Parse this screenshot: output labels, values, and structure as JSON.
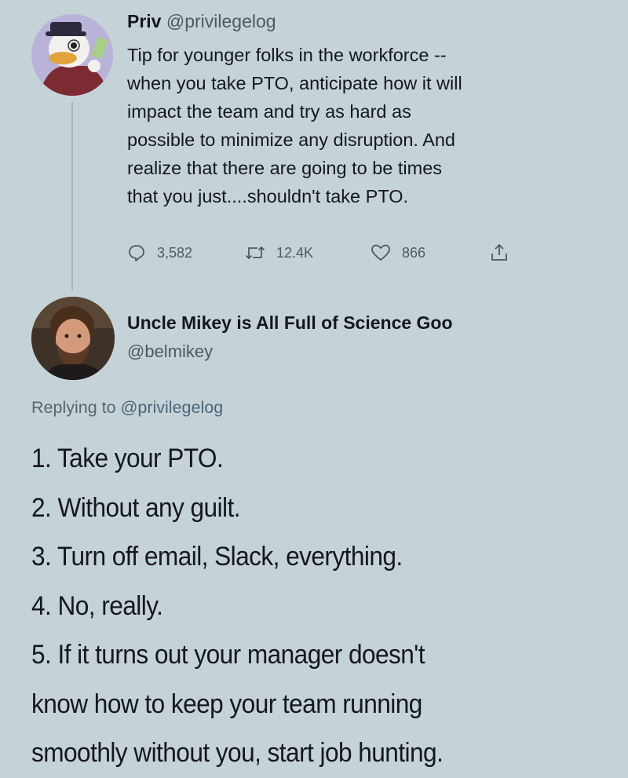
{
  "tweet": {
    "author": {
      "display_name": "Priv",
      "handle": "@privilegelog"
    },
    "text": "Tip for younger folks in the workforce --\nwhen you take PTO, anticipate how it will\nimpact the team and try as hard as\npossible to minimize any disruption. And\nrealize that there are going to be times\nthat you just....shouldn't take PTO.",
    "stats": {
      "replies": "3,582",
      "retweets": "12.4K",
      "likes": "866"
    },
    "icons": [
      "reply-icon",
      "retweet-icon",
      "like-icon",
      "share-icon"
    ]
  },
  "reply": {
    "author": {
      "display_name": "Uncle Mikey is All Full of Science Goo",
      "handle": "@belmikey"
    },
    "replying_prefix": "Replying to",
    "replying_to": "@privilegelog",
    "lines": [
      "1. Take your PTO.",
      "2. Without any guilt.",
      "3. Turn off email, Slack, everything.",
      "4. No, really.",
      "5. If it turns out your manager doesn't",
      "know how to keep your team running",
      "smoothly without you, start job hunting."
    ]
  },
  "colors": {
    "background": "#c5d3d9",
    "text": "#15181a",
    "secondary_text": "#4d5a61"
  }
}
